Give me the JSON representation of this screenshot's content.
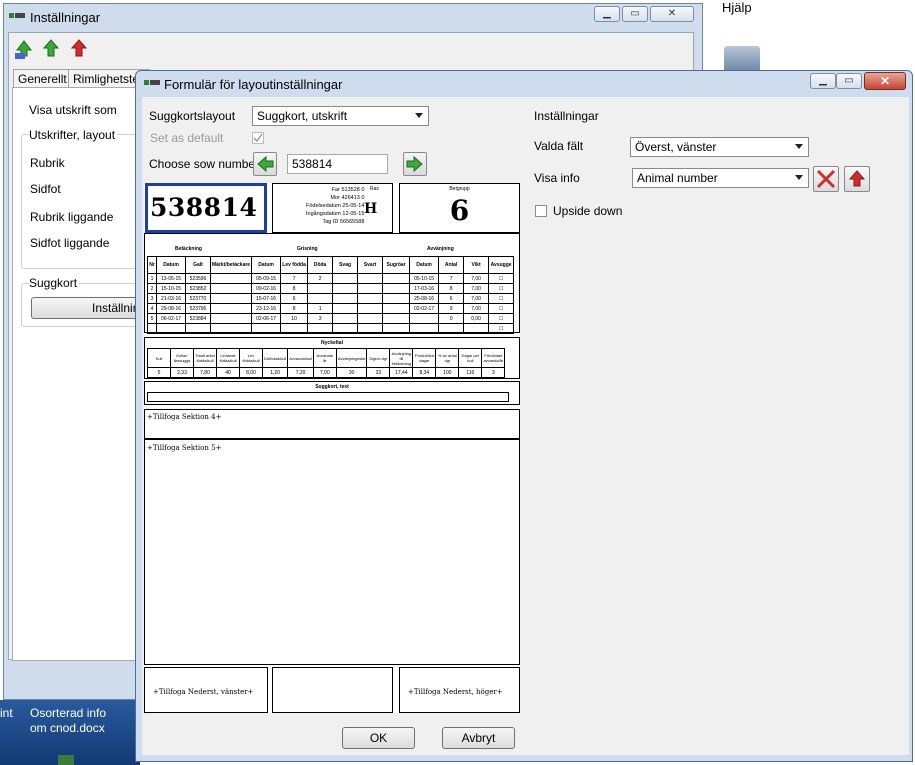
{
  "desktop": {
    "menubar_help": "Hjälp",
    "icon_label_partial": "int",
    "file_label_line1": "Osorterad info",
    "file_label_line2": "om cnod.docx"
  },
  "bg_window": {
    "title": "Inställningar",
    "tabs": [
      "Generellt",
      "Rimlighetstes"
    ],
    "visa_utskrift": "Visa utskrift som",
    "group_title": "Utskrifter, layout",
    "items": [
      "Rubrik",
      "Sidfot",
      "Rubrik liggande",
      "Sidfot liggande"
    ],
    "suggkort_group": "Suggkort",
    "settings_button": "Inställning"
  },
  "dialog": {
    "title": "Formulär för layoutinställningar",
    "suggkortslayout_label": "Suggkortslayout",
    "suggkortslayout_value": "Suggkort, utskrift",
    "set_default_label": "Set as default",
    "set_default_checked": true,
    "choose_sow_label": "Choose sow number",
    "sow_number": "538814",
    "settings_title": "Inställningar",
    "valda_falt_label": "Valda fält",
    "valda_falt_value": "Överst, vänster",
    "visa_info_label": "Visa info",
    "visa_info_value": "Animal number",
    "upside_down_label": "Upside down",
    "upside_down_checked": false,
    "ok_button": "OK",
    "cancel_button": "Avbryt"
  },
  "preview": {
    "sow_number": "538814",
    "info_lines": [
      "Far 513528 0",
      "Mor 426413 0",
      "Födelsedatum 25-05-14",
      "Ingångsdatum 12-05-15",
      "Tag ID 56565588"
    ],
    "ras_label": "Ras",
    "ras_value": "H",
    "group_label": "Betgrupp",
    "group_value": "6",
    "section_headers": [
      "Betäckning",
      "Grisning",
      "Avvänjning"
    ],
    "columns": [
      "Nr",
      "Datum",
      "Galt",
      "Märkt/betäckare",
      "Datum",
      "Lev födda",
      "Döda",
      "Svag",
      "Svart",
      "Sugröar",
      "Datum",
      "Antal",
      "Vikt",
      "Avsugge"
    ],
    "rows": [
      [
        "1",
        "13-05-15",
        "523596",
        "",
        "05-09-15",
        "7",
        "2",
        "",
        "",
        "",
        "05-10-15",
        "7",
        "7,00",
        "☐"
      ],
      [
        "2",
        "15-10-15",
        "523852",
        "",
        "09-02-16",
        "8",
        "",
        "",
        "",
        "",
        "17-03-16",
        "8",
        "7,00",
        "☐"
      ],
      [
        "3",
        "21-03-16",
        "523770",
        "",
        "15-07-16",
        "6",
        "",
        "",
        "",
        "",
        "25-08-16",
        "6",
        "7,00",
        "☐"
      ],
      [
        "4",
        "29-08-16",
        "523796",
        "",
        "23-12-16",
        "8",
        "1",
        "",
        "",
        "",
        "02-02-17",
        "9",
        "7,00",
        "☐"
      ],
      [
        "5",
        "06-02-17",
        "523884",
        "",
        "02-06-17",
        "10",
        "3",
        "",
        "",
        "",
        "",
        "0",
        "0,00",
        "☐"
      ],
      [
        "",
        "",
        "",
        "",
        "",
        "",
        "",
        "",
        "",
        "",
        "",
        "",
        "",
        "☐"
      ]
    ],
    "nyckeltal_title": "Nyckeltal",
    "nyckeltal_headers": [
      "Kull",
      "Kullar/årssugga",
      "Totalt antal födda/kull",
      "Levande födda/kull",
      "Lev födda/kull",
      "Döfödda/kull",
      "Avvanda/kull",
      "Avvanda/år",
      "Avvänjningsvikt",
      "Digivn.dgr",
      "Avvänjning till betäckning",
      "Produktiva dagar",
      "% av antal dgr",
      "Dagar per kull",
      "Förväntad avvanda/år"
    ],
    "nyckeltal_values": [
      "5",
      "2,33",
      "7,80",
      "40",
      "8,00",
      "1,20",
      "7,20",
      "7,00",
      "30",
      "33",
      "17,44",
      "8,34",
      "100",
      "116",
      "3"
    ],
    "suggkort_text": "Suggkort, text",
    "section4": "+Tillfoga Sektion 4+",
    "section5": "+Tillfoga Sektion 5+",
    "footer_left": "+Tillfoga Nederst, vänster+",
    "footer_right": "+Tillfoga Nederst, höger+"
  },
  "colors": {
    "titlebar": "#cedcee",
    "close_red": "#c7452f",
    "arrow_green": "#3aa83a",
    "arrow_red": "#d32c2c",
    "sow_border": "#1b3ea8"
  }
}
